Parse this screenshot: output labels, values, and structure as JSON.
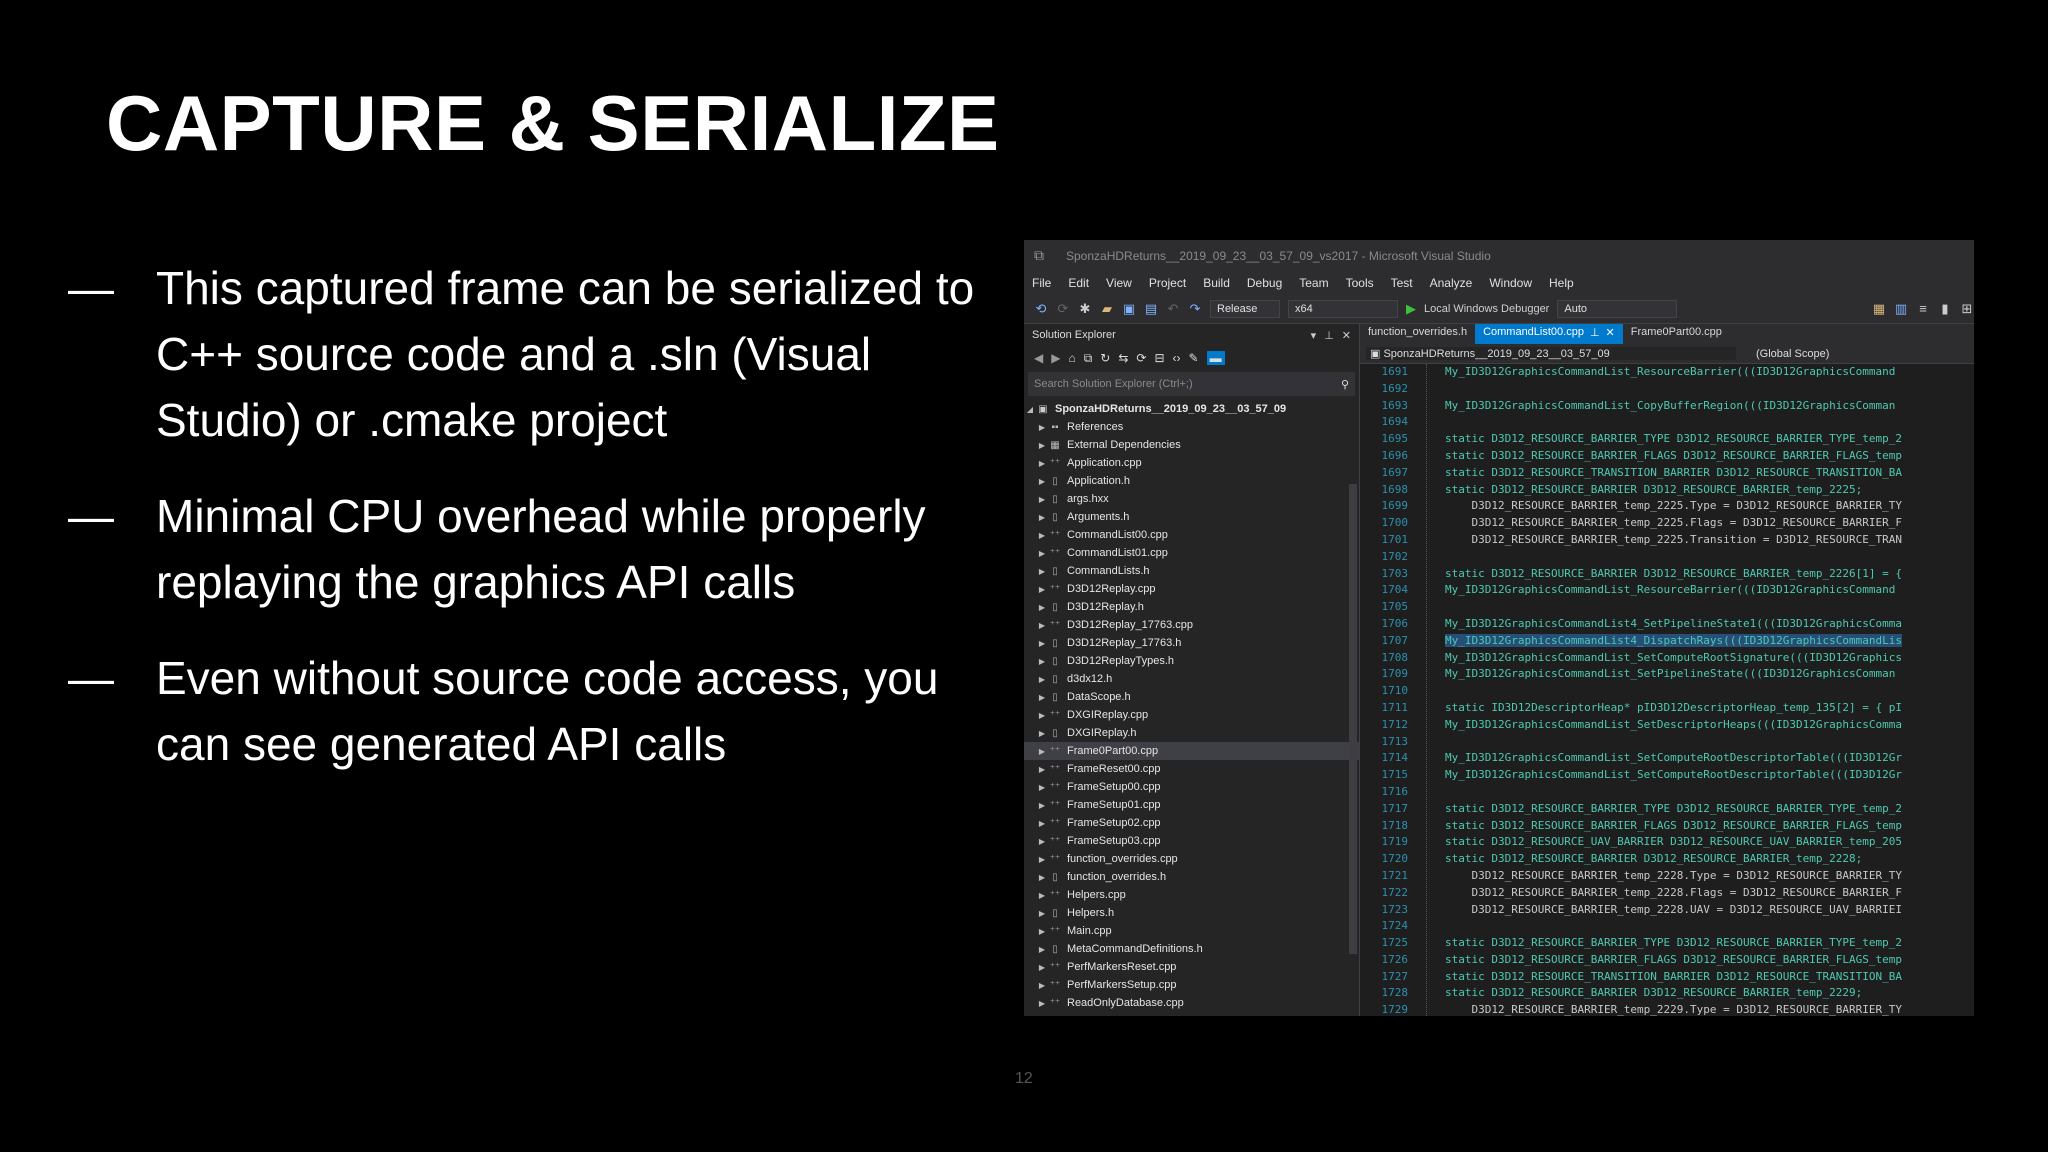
{
  "slide": {
    "title": "CAPTURE & SERIALIZE",
    "bullets": [
      {
        "dash": "—",
        "text": "This captured frame can be serialized to C++ source code and a .sln (Visual Studio) or .cmake project"
      },
      {
        "dash": "—",
        "text": "Minimal CPU overhead while properly replaying the graphics API calls"
      },
      {
        "dash": "—",
        "text": "Even without source code access, you can see generated API calls"
      }
    ],
    "page_number": "12"
  },
  "vs": {
    "title": "SponzaHDReturns__2019_09_23__03_57_09_vs2017 - Microsoft Visual Studio",
    "menu": [
      "File",
      "Edit",
      "View",
      "Project",
      "Build",
      "Debug",
      "Team",
      "Tools",
      "Test",
      "Analyze",
      "Window",
      "Help"
    ],
    "toolbar": {
      "config": "Release",
      "platform": "x64",
      "debugger": "Local Windows Debugger",
      "mode": "Auto"
    },
    "solution_explorer": {
      "header": "Solution Explorer",
      "search_placeholder": "Search Solution Explorer (Ctrl+;)",
      "root": "SponzaHDReturns__2019_09_23__03_57_09",
      "items": [
        {
          "label": "References",
          "kind": "ref"
        },
        {
          "label": "External Dependencies",
          "kind": "ext"
        },
        {
          "label": "Application.cpp",
          "kind": "cpp"
        },
        {
          "label": "Application.h",
          "kind": "h"
        },
        {
          "label": "args.hxx",
          "kind": "h"
        },
        {
          "label": "Arguments.h",
          "kind": "h"
        },
        {
          "label": "CommandList00.cpp",
          "kind": "cpp"
        },
        {
          "label": "CommandList01.cpp",
          "kind": "cpp"
        },
        {
          "label": "CommandLists.h",
          "kind": "h"
        },
        {
          "label": "D3D12Replay.cpp",
          "kind": "cpp"
        },
        {
          "label": "D3D12Replay.h",
          "kind": "h"
        },
        {
          "label": "D3D12Replay_17763.cpp",
          "kind": "cpp"
        },
        {
          "label": "D3D12Replay_17763.h",
          "kind": "h"
        },
        {
          "label": "D3D12ReplayTypes.h",
          "kind": "h"
        },
        {
          "label": "d3dx12.h",
          "kind": "h"
        },
        {
          "label": "DataScope.h",
          "kind": "h"
        },
        {
          "label": "DXGIReplay.cpp",
          "kind": "cpp"
        },
        {
          "label": "DXGIReplay.h",
          "kind": "h"
        },
        {
          "label": "Frame0Part00.cpp",
          "kind": "cpp",
          "selected": true
        },
        {
          "label": "FrameReset00.cpp",
          "kind": "cpp"
        },
        {
          "label": "FrameSetup00.cpp",
          "kind": "cpp"
        },
        {
          "label": "FrameSetup01.cpp",
          "kind": "cpp"
        },
        {
          "label": "FrameSetup02.cpp",
          "kind": "cpp"
        },
        {
          "label": "FrameSetup03.cpp",
          "kind": "cpp"
        },
        {
          "label": "function_overrides.cpp",
          "kind": "cpp"
        },
        {
          "label": "function_overrides.h",
          "kind": "h"
        },
        {
          "label": "Helpers.cpp",
          "kind": "cpp"
        },
        {
          "label": "Helpers.h",
          "kind": "h"
        },
        {
          "label": "Main.cpp",
          "kind": "cpp"
        },
        {
          "label": "MetaCommandDefinitions.h",
          "kind": "h"
        },
        {
          "label": "PerfMarkersReset.cpp",
          "kind": "cpp"
        },
        {
          "label": "PerfMarkersSetup.cpp",
          "kind": "cpp"
        },
        {
          "label": "ReadOnlyDatabase.cpp",
          "kind": "cpp"
        }
      ]
    },
    "editor": {
      "tabs": [
        "function_overrides.h",
        "CommandList00.cpp",
        "Frame0Part00.cpp"
      ],
      "active_tab": "CommandList00.cpp",
      "project_dropdown": "SponzaHDReturns__2019_09_23__03_57_09",
      "scope": "(Global Scope)",
      "lines": [
        {
          "n": "1691",
          "code": "My_ID3D12GraphicsCommandList_ResourceBarrier(((ID3D12GraphicsCommand"
        },
        {
          "n": "1692",
          "code": ""
        },
        {
          "n": "1693",
          "code": "My_ID3D12GraphicsCommandList_CopyBufferRegion(((ID3D12GraphicsComman"
        },
        {
          "n": "1694",
          "code": ""
        },
        {
          "n": "1695",
          "code": "static D3D12_RESOURCE_BARRIER_TYPE D3D12_RESOURCE_BARRIER_TYPE_temp_2"
        },
        {
          "n": "1696",
          "code": "static D3D12_RESOURCE_BARRIER_FLAGS D3D12_RESOURCE_BARRIER_FLAGS_temp"
        },
        {
          "n": "1697",
          "code": "static D3D12_RESOURCE_TRANSITION_BARRIER D3D12_RESOURCE_TRANSITION_BA"
        },
        {
          "n": "1698",
          "code": "static D3D12_RESOURCE_BARRIER D3D12_RESOURCE_BARRIER_temp_2225;"
        },
        {
          "n": "1699",
          "code": "    D3D12_RESOURCE_BARRIER_temp_2225.Type = D3D12_RESOURCE_BARRIER_TY"
        },
        {
          "n": "1700",
          "code": "    D3D12_RESOURCE_BARRIER_temp_2225.Flags = D3D12_RESOURCE_BARRIER_F"
        },
        {
          "n": "1701",
          "code": "    D3D12_RESOURCE_BARRIER_temp_2225.Transition = D3D12_RESOURCE_TRAN"
        },
        {
          "n": "1702",
          "code": ""
        },
        {
          "n": "1703",
          "code": "static D3D12_RESOURCE_BARRIER D3D12_RESOURCE_BARRIER_temp_2226[1] = {"
        },
        {
          "n": "1704",
          "code": "My_ID3D12GraphicsCommandList_ResourceBarrier(((ID3D12GraphicsCommand"
        },
        {
          "n": "1705",
          "code": ""
        },
        {
          "n": "1706",
          "code": "My_ID3D12GraphicsCommandList4_SetPipelineState1(((ID3D12GraphicsComma"
        },
        {
          "n": "1707",
          "code": "My_ID3D12GraphicsCommandList4_DispatchRays(((ID3D12GraphicsCommandLis",
          "highlight": true
        },
        {
          "n": "1708",
          "code": "My_ID3D12GraphicsCommandList_SetComputeRootSignature(((ID3D12Graphics"
        },
        {
          "n": "1709",
          "code": "My_ID3D12GraphicsCommandList_SetPipelineState(((ID3D12GraphicsComman"
        },
        {
          "n": "1710",
          "code": ""
        },
        {
          "n": "1711",
          "code": "static ID3D12DescriptorHeap* pID3D12DescriptorHeap_temp_135[2] = { pI"
        },
        {
          "n": "1712",
          "code": "My_ID3D12GraphicsCommandList_SetDescriptorHeaps(((ID3D12GraphicsComma"
        },
        {
          "n": "1713",
          "code": ""
        },
        {
          "n": "1714",
          "code": "My_ID3D12GraphicsCommandList_SetComputeRootDescriptorTable(((ID3D12Gr"
        },
        {
          "n": "1715",
          "code": "My_ID3D12GraphicsCommandList_SetComputeRootDescriptorTable(((ID3D12Gr"
        },
        {
          "n": "1716",
          "code": ""
        },
        {
          "n": "1717",
          "code": "static D3D12_RESOURCE_BARRIER_TYPE D3D12_RESOURCE_BARRIER_TYPE_temp_2"
        },
        {
          "n": "1718",
          "code": "static D3D12_RESOURCE_BARRIER_FLAGS D3D12_RESOURCE_BARRIER_FLAGS_temp"
        },
        {
          "n": "1719",
          "code": "static D3D12_RESOURCE_UAV_BARRIER D3D12_RESOURCE_UAV_BARRIER_temp_205"
        },
        {
          "n": "1720",
          "code": "static D3D12_RESOURCE_BARRIER D3D12_RESOURCE_BARRIER_temp_2228;"
        },
        {
          "n": "1721",
          "code": "    D3D12_RESOURCE_BARRIER_temp_2228.Type = D3D12_RESOURCE_BARRIER_TY"
        },
        {
          "n": "1722",
          "code": "    D3D12_RESOURCE_BARRIER_temp_2228.Flags = D3D12_RESOURCE_BARRIER_F"
        },
        {
          "n": "1723",
          "code": "    D3D12_RESOURCE_BARRIER_temp_2228.UAV = D3D12_RESOURCE_UAV_BARRIEI"
        },
        {
          "n": "1724",
          "code": ""
        },
        {
          "n": "1725",
          "code": "static D3D12_RESOURCE_BARRIER_TYPE D3D12_RESOURCE_BARRIER_TYPE_temp_2"
        },
        {
          "n": "1726",
          "code": "static D3D12_RESOURCE_BARRIER_FLAGS D3D12_RESOURCE_BARRIER_FLAGS_temp"
        },
        {
          "n": "1727",
          "code": "static D3D12_RESOURCE_TRANSITION_BARRIER D3D12_RESOURCE_TRANSITION_BA"
        },
        {
          "n": "1728",
          "code": "static D3D12_RESOURCE_BARRIER D3D12_RESOURCE_BARRIER_temp_2229;"
        },
        {
          "n": "1729",
          "code": "    D3D12_RESOURCE_BARRIER_temp_2229.Type = D3D12_RESOURCE_BARRIER_TY"
        }
      ]
    }
  }
}
